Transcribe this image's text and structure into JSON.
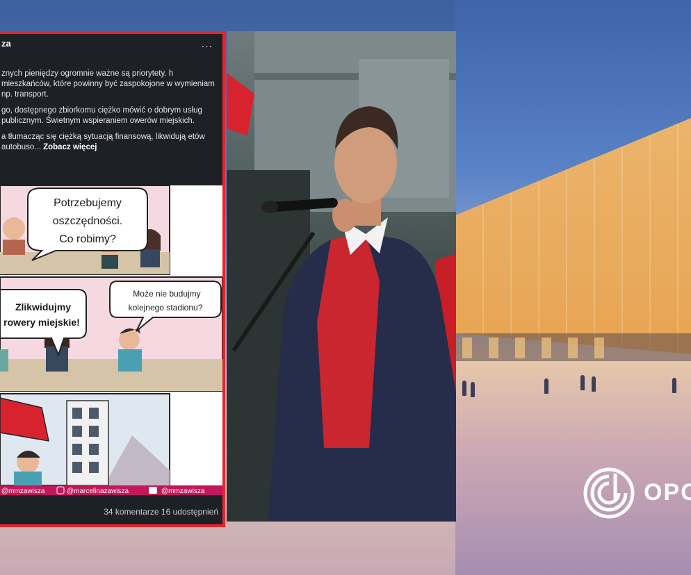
{
  "post": {
    "author": "za",
    "more_label": "...",
    "paragraphs": [
      "znych pieniędzy ogromnie ważne są priorytety. h mieszkańców, które powinny być zaspokojone w wymieniam np. transport.",
      "go, dostępnego zbiorkomu ciężko mówić o dobrym usług publicznym. Świetnym wspieraniem owerów miejskich."
    ],
    "last_paragraph": "a tłumacząc się ciężką sytuacją finansową, likwidują etów autobuso...",
    "see_more": "Zobacz więcej",
    "footer": "34 komentarze  16 udostępnień"
  },
  "comic": {
    "bubble_top": [
      "Potrzebujemy",
      "oszczędności.",
      "Co robimy?"
    ],
    "bubble_left": [
      "Zlikwidujmy",
      "rowery miejskie!"
    ],
    "bubble_right": [
      "Może nie budujmy",
      "kolejnego stadionu?"
    ],
    "handles": [
      "@mmzawisza",
      "@marcelinazawisza",
      "@mmzawisza"
    ]
  },
  "logo": {
    "text": "OPO"
  }
}
